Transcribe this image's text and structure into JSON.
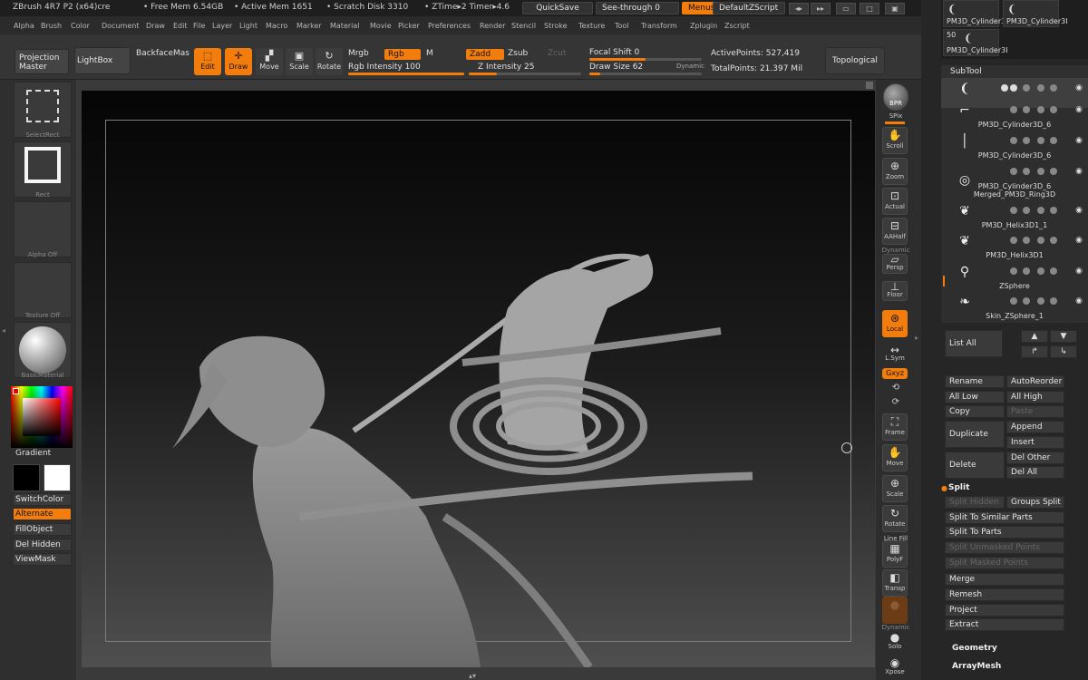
{
  "titlebar": {
    "app": "ZBrush 4R7 P2 (x64)cre",
    "free_mem": "• Free Mem 6.54GB",
    "active_mem": "• Active Mem 1651",
    "scratch": "• Scratch Disk 3310",
    "ztime": "• ZTime▸2 Timer▸4.6",
    "quicksave": "QuickSave",
    "seethrough": "See-through  0",
    "menus": "Menus",
    "script": "DefaultZScript"
  },
  "menu": [
    "Alpha",
    "Brush",
    "Color",
    "Document",
    "Draw",
    "Edit",
    "File",
    "Layer",
    "Light",
    "Macro",
    "Marker",
    "Material",
    "Movie",
    "Picker",
    "Preferences",
    "Render",
    "Stencil",
    "Stroke",
    "Texture",
    "Tool",
    "Transform",
    "Zplugin",
    "Zscript"
  ],
  "shelf": {
    "projection_master": "Projection Master",
    "lightbox": "LightBox",
    "backface": "BackfaceMas",
    "edit": "Edit",
    "draw": "Draw",
    "move": "Move",
    "scale": "Scale",
    "rotate": "Rotate",
    "mrgb": "Mrgb",
    "rgb": "Rgb",
    "m": "M",
    "zadd": "Zadd",
    "zsub": "Zsub",
    "zcut": "Zcut",
    "rgb_intensity": "Rgb Intensity 100",
    "z_intensity": "Z Intensity 25",
    "focal_shift": "Focal Shift 0",
    "draw_size": "Draw Size 62",
    "dynamic": "Dynamic",
    "active_points": "ActivePoints: 527,419",
    "total_points": "TotalPoints: 21.397 Mil",
    "topological": "Topological"
  },
  "shelf_levels": {
    "rgb_intensity": 1.0,
    "z_intensity": 0.25,
    "focal_shift": 0.5,
    "draw_size": 0.1
  },
  "left": {
    "select_rect": "SelectRect",
    "rect": "Rect",
    "alpha": "Alpha Off",
    "texture": "Texture Off",
    "material": "BasicMaterial",
    "gradient": "Gradient",
    "switch_color": "SwitchColor",
    "alternate": "Alternate",
    "fill_object": "FillObject",
    "del_hidden": "Del Hidden",
    "view_mask": "ViewMask"
  },
  "right_shelf": {
    "bpr": "BPR",
    "spix": "SPix",
    "scroll": "Scroll",
    "zoom": "Zoom",
    "actual": "Actual",
    "aahalf": "AAHalf",
    "dynamic": "Dynamic",
    "persp": "Persp",
    "floor": "Floor",
    "local": "Local",
    "lsym": "L.Sym",
    "xyz": "Gxyz",
    "frame": "Frame",
    "move": "Move",
    "scale": "Scale",
    "rotate": "Rotate",
    "linefill": "Line Fill",
    "polyf": "PolyF",
    "transp": "Transp",
    "dynamic2": "Dynamic",
    "solo": "Solo",
    "xpose": "Xpose"
  },
  "tool_palette": {
    "thumb1": "PM3D_Cylinder3I",
    "thumb2": "PM3D_Cylinder3I",
    "count": "50",
    "thumb3": "PM3D_Cylinder3I"
  },
  "subtool": {
    "header": "SubTool",
    "items": [
      {
        "name": "",
        "active": true
      },
      {
        "name": "PM3D_Cylinder3D_6"
      },
      {
        "name": "PM3D_Cylinder3D_6"
      },
      {
        "name": "PM3D_Cylinder3D_6"
      },
      {
        "name": "Merged_PM3D_Ring3D"
      },
      {
        "name": "PM3D_Helix3D1_1"
      },
      {
        "name": "PM3D_Helix3D1"
      },
      {
        "name": "ZSphere"
      },
      {
        "name": "Skin_ZSphere_1"
      }
    ],
    "list_all": "List All",
    "rename": "Rename",
    "auto_reorder": "AutoReorder",
    "all_low": "All Low",
    "all_high": "All High",
    "copy": "Copy",
    "paste": "Paste",
    "duplicate": "Duplicate",
    "append": "Append",
    "insert": "Insert",
    "delete": "Delete",
    "del_other": "Del Other",
    "del_all": "Del All",
    "split": "Split",
    "split_hidden": "Split Hidden",
    "groups_split": "Groups Split",
    "split_similar": "Split To Similar Parts",
    "split_parts": "Split To Parts",
    "split_unmasked": "Split Unmasked Points",
    "split_masked": "Split Masked Points",
    "merge": "Merge",
    "remesh": "Remesh",
    "project": "Project",
    "extract": "Extract",
    "geometry": "Geometry",
    "arraymesh": "ArrayMesh"
  }
}
